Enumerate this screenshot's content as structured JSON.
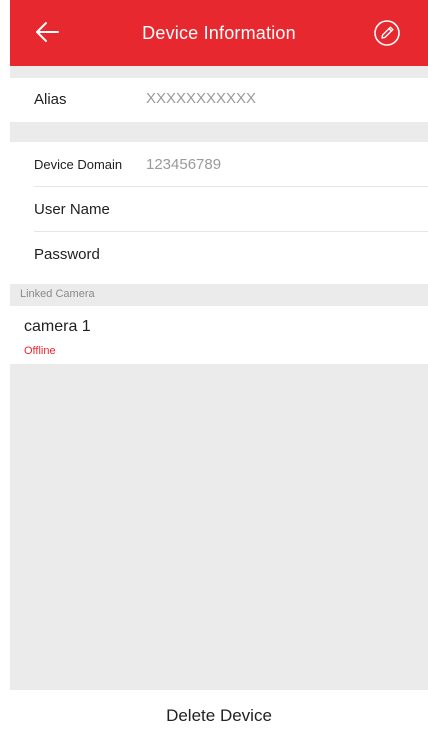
{
  "header": {
    "title": "Device Information",
    "back_icon": "arrow-left-icon",
    "edit_icon": "pencil-circle-icon",
    "background_color": "#e8282f"
  },
  "info": {
    "alias_label": "Alias",
    "alias_value": "XXXXXXXXXXX",
    "domain_label": "Device Domain",
    "domain_value": "123456789",
    "username_label": "User Name",
    "password_label": "Password"
  },
  "linked_camera": {
    "section_label": "Linked Camera",
    "cameras": [
      {
        "name": "camera 1",
        "status": "Offline",
        "status_color": "#e8282f"
      }
    ]
  },
  "footer": {
    "delete_label": "Delete Device"
  }
}
